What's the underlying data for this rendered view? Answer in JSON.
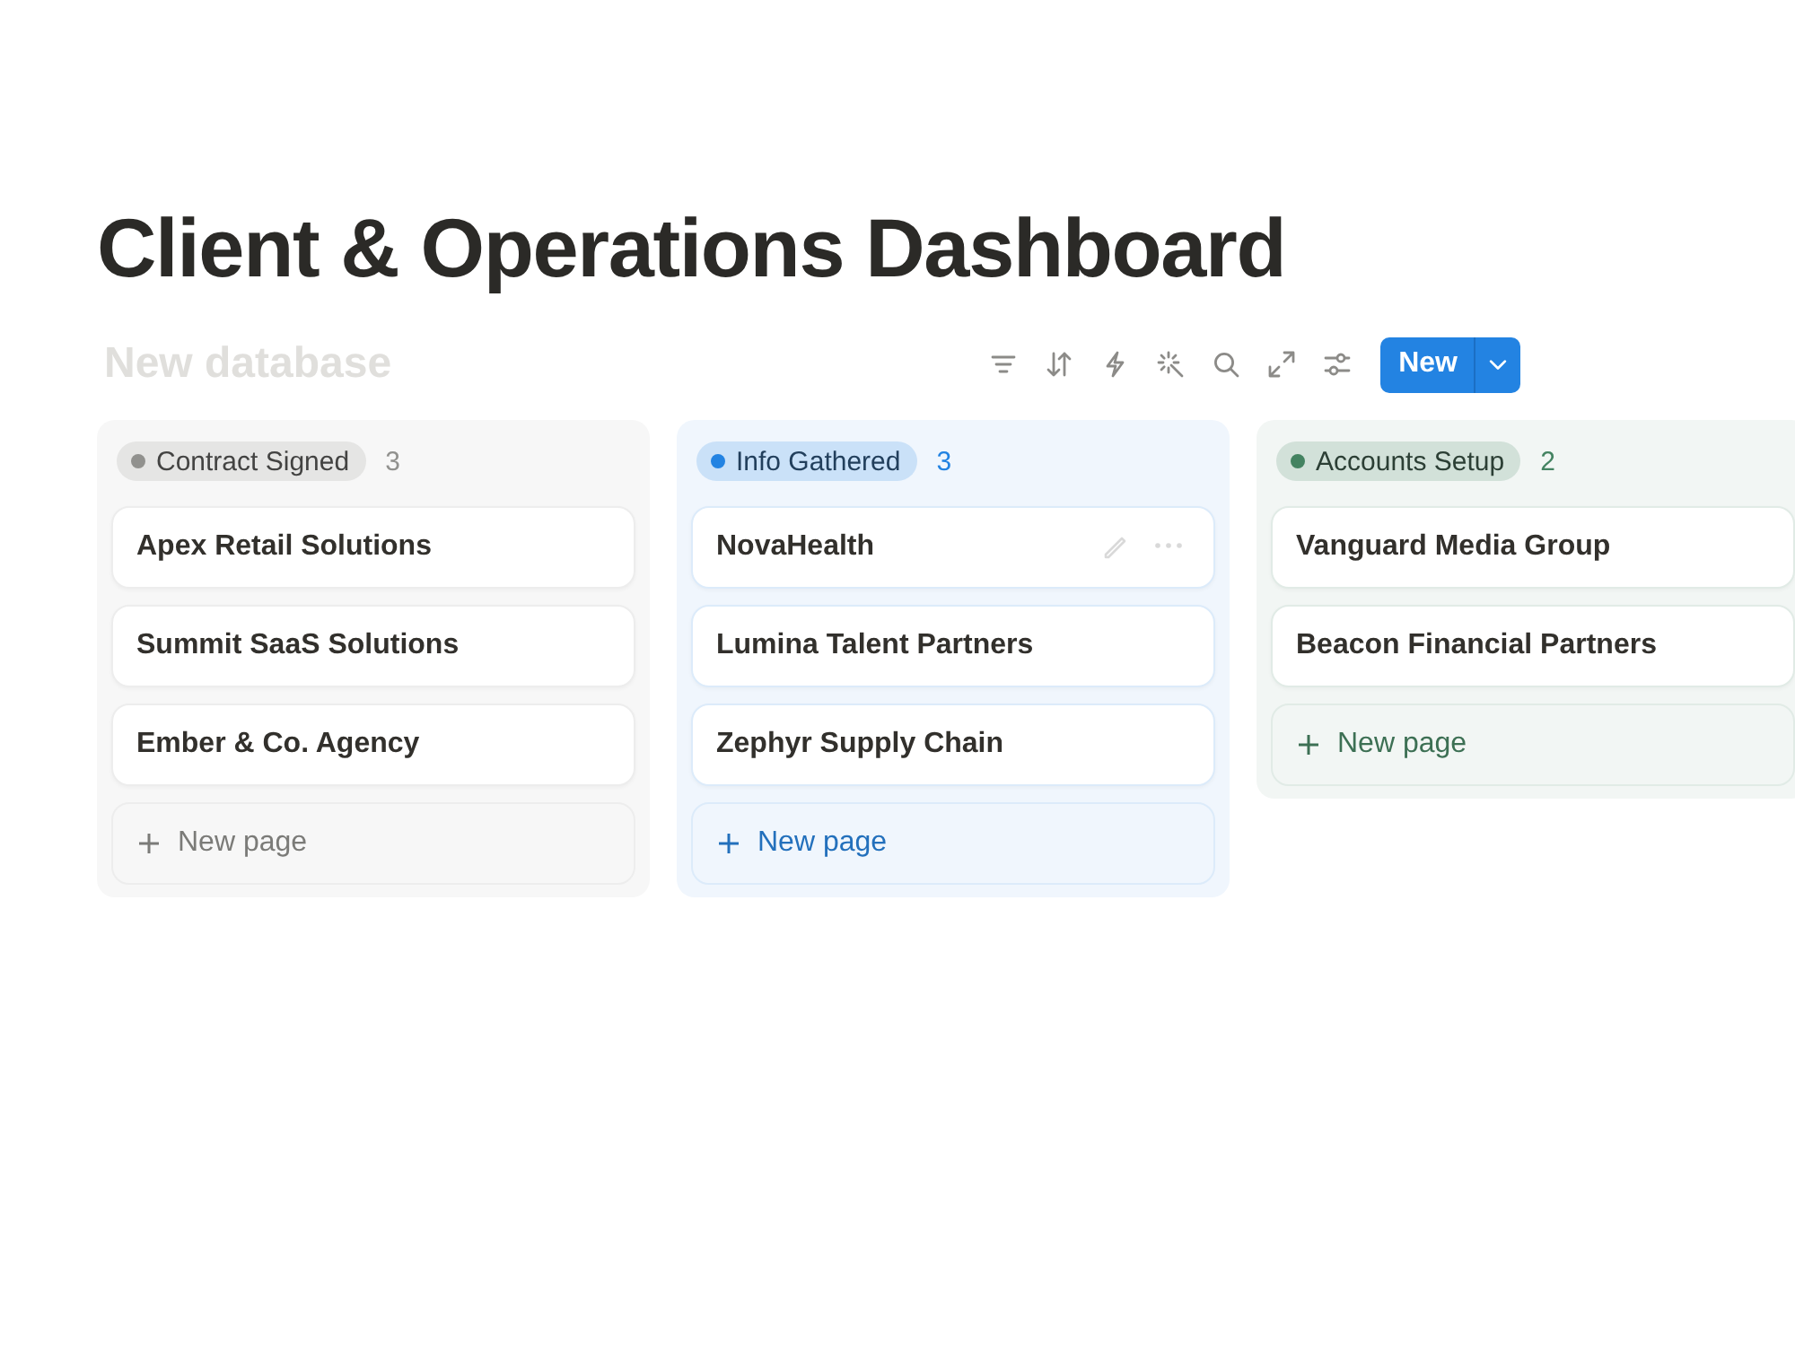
{
  "page": {
    "title": "Client & Operations Dashboard"
  },
  "database": {
    "placeholder": "New database",
    "new_button": {
      "label": "New"
    }
  },
  "columns": [
    {
      "status": "Contract Signed",
      "color": "#91918e",
      "count": "3",
      "cards": [
        {
          "title": "Apex Retail Solutions",
          "hovered": false
        },
        {
          "title": "Summit SaaS Solutions",
          "hovered": false
        },
        {
          "title": "Ember & Co. Agency",
          "hovered": false
        }
      ],
      "new_page_label": "New page"
    },
    {
      "status": "Info Gathered",
      "color": "#2383e2",
      "count": "3",
      "cards": [
        {
          "title": "NovaHealth",
          "hovered": true
        },
        {
          "title": "Lumina Talent Partners",
          "hovered": false
        },
        {
          "title": "Zephyr Supply Chain",
          "hovered": false
        }
      ],
      "new_page_label": "New page"
    },
    {
      "status": "Accounts Setup",
      "color": "#448361",
      "count": "2",
      "cards": [
        {
          "title": "Vanguard Media Group",
          "hovered": false
        },
        {
          "title": "Beacon Financial Partners",
          "hovered": false
        }
      ],
      "new_page_label": "New page"
    }
  ]
}
